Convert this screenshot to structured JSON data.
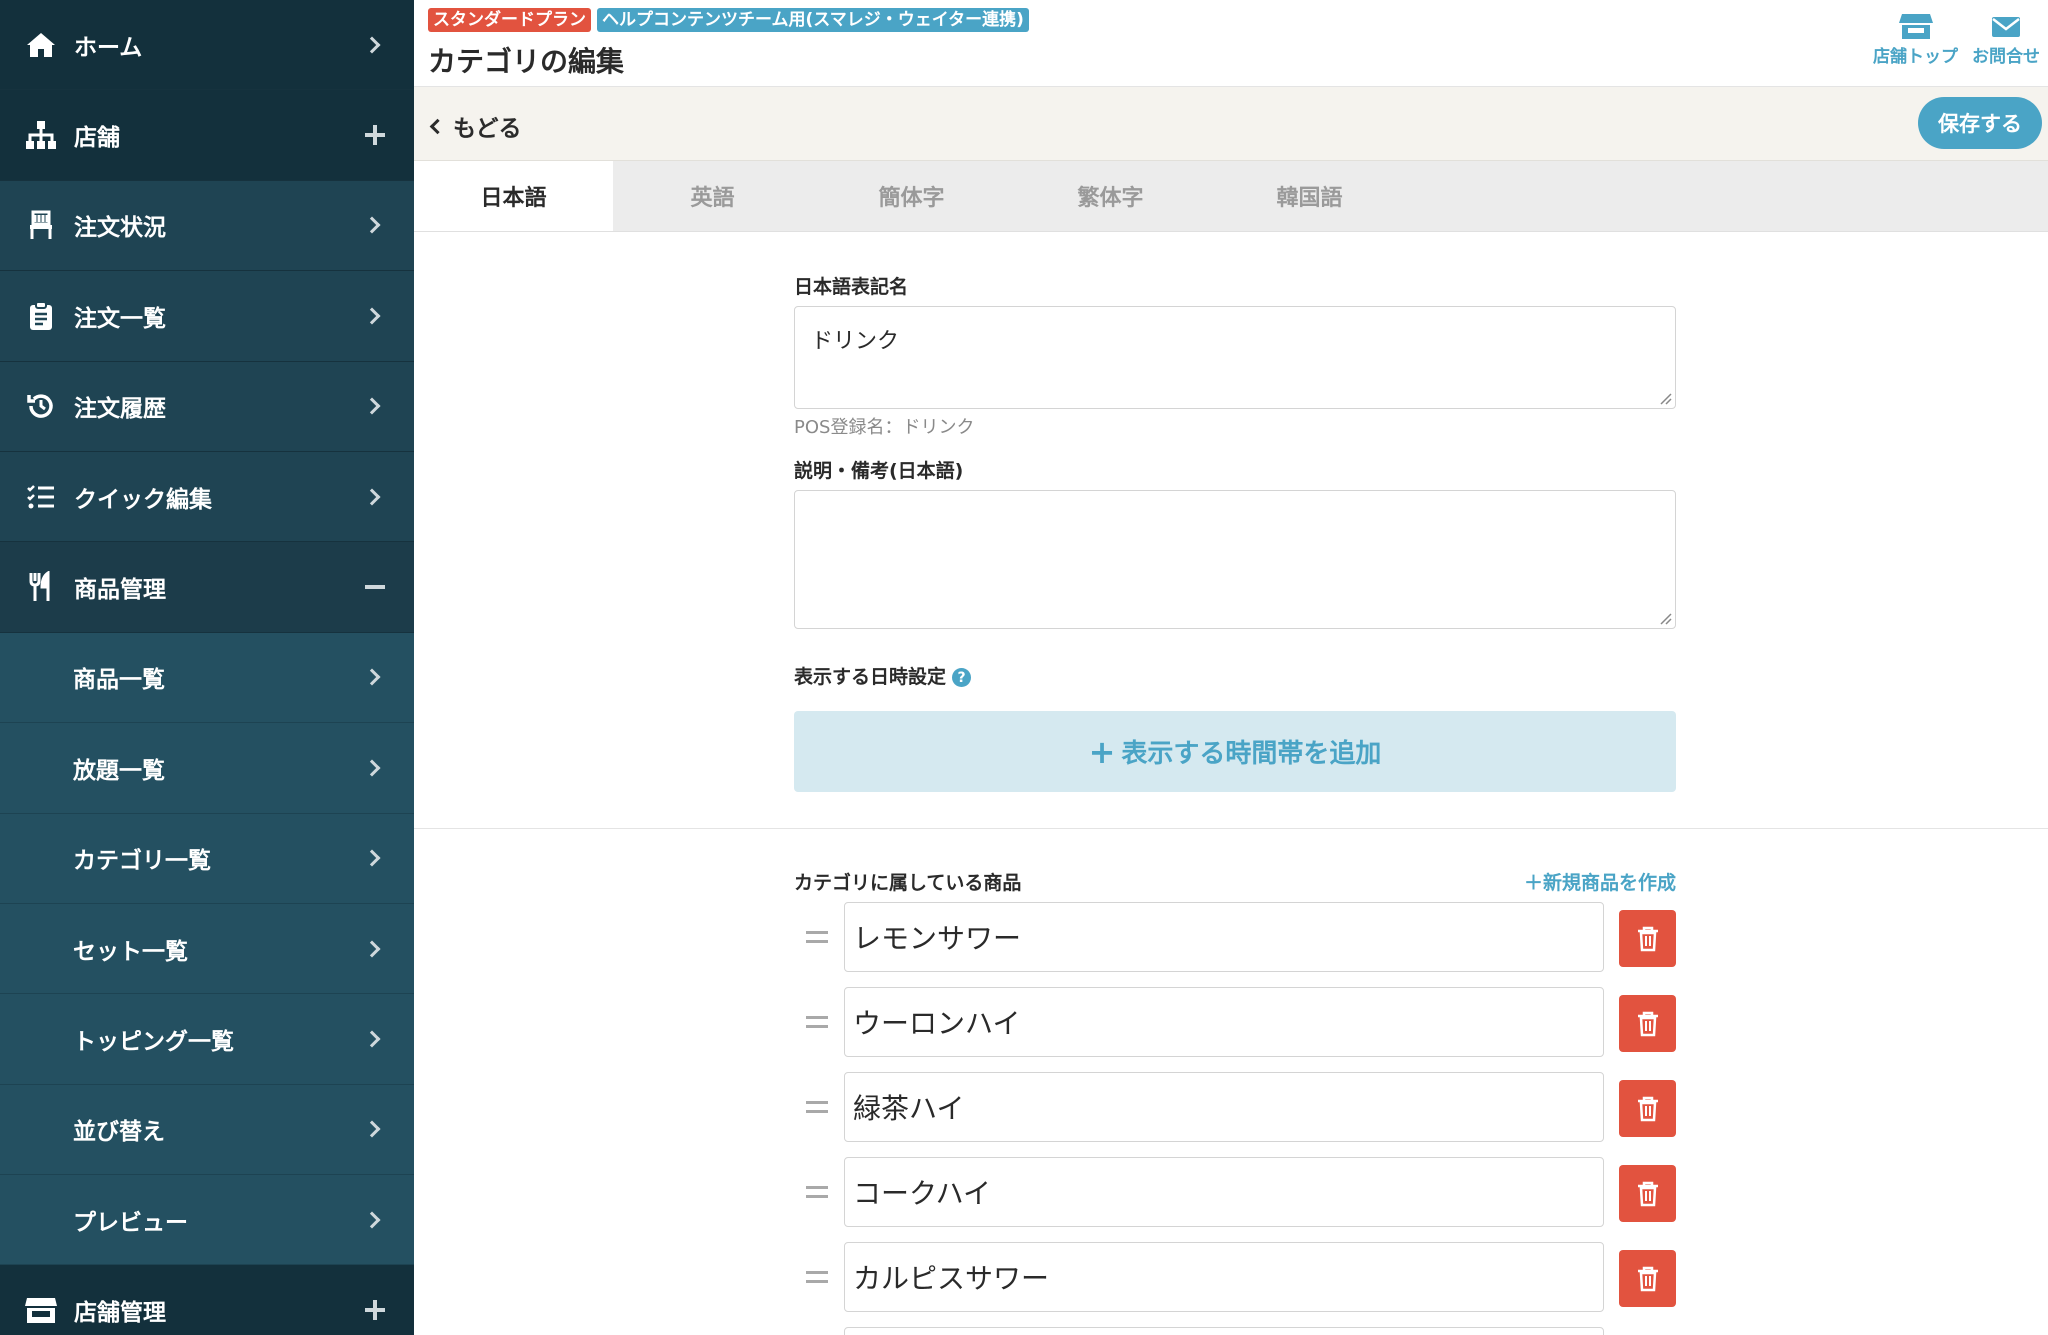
{
  "sidebar": {
    "items": [
      {
        "label": "ホーム",
        "icon": "home-icon"
      },
      {
        "label": "店舗",
        "icon": "sitemap-icon"
      },
      {
        "label": "注文状況",
        "icon": "chair-icon"
      },
      {
        "label": "注文一覧",
        "icon": "clipboard-icon"
      },
      {
        "label": "注文履歴",
        "icon": "history-icon"
      },
      {
        "label": "クイック編集",
        "icon": "list-icon"
      },
      {
        "label": "商品管理",
        "icon": "utensils-icon"
      }
    ],
    "subitems": [
      {
        "label": "商品一覧"
      },
      {
        "label": "放題一覧"
      },
      {
        "label": "カテゴリ一覧"
      },
      {
        "label": "セット一覧"
      },
      {
        "label": "トッピング一覧"
      },
      {
        "label": "並び替え"
      },
      {
        "label": "プレビュー"
      }
    ],
    "bottom": {
      "label": "店舗管理",
      "icon": "store-icon"
    }
  },
  "header": {
    "plan_badge": "スタンダードプラン",
    "team_badge": "ヘルプコンテンツチーム用(スマレジ・ウェイター連携)",
    "title": "カテゴリの編集",
    "links": {
      "store_top": "店舗トップ",
      "contact": "お問合せ"
    }
  },
  "actionbar": {
    "back": "もどる",
    "save": "保存する"
  },
  "tabs": [
    "日本語",
    "英語",
    "簡体字",
    "繁体字",
    "韓国語"
  ],
  "form": {
    "name_label": "日本語表記名",
    "name_value": "ドリンク",
    "pos_hint": "POS登録名：ドリンク",
    "desc_label": "説明・備考(日本語)",
    "desc_value": "",
    "time_label": "表示する日時設定",
    "add_time": "表示する時間帯を追加"
  },
  "products": {
    "label": "カテゴリに属している商品",
    "new_link": "新規商品を作成",
    "items": [
      "レモンサワー",
      "ウーロンハイ",
      "緑茶ハイ",
      "コークハイ",
      "カルピスサワー"
    ]
  },
  "colors": {
    "sidebar": "#1c3c4a",
    "accent": "#4aa4c6",
    "danger": "#e2533f"
  }
}
